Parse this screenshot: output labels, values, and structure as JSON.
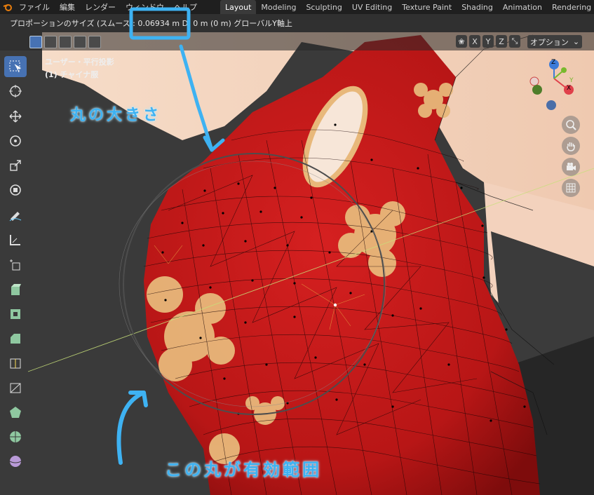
{
  "menu": {
    "items": [
      "ファイル",
      "編集",
      "レンダー",
      "ウィンドウ",
      "ヘルプ"
    ]
  },
  "workspaces": {
    "tabs": [
      "Layout",
      "Modeling",
      "Sculpting",
      "UV Editing",
      "Texture Paint",
      "Shading",
      "Animation",
      "Rendering"
    ],
    "active": "Layout"
  },
  "status": {
    "text": "プロポーションのサイズ (スムース : 0.06934 m   D: 0 m (0 m) グローバルY軸上"
  },
  "header": {
    "axis_labels": [
      "X",
      "Y",
      "Z"
    ],
    "options_label": "オプション"
  },
  "viewport": {
    "view_label": "ユーザー・平行投影",
    "object_label": "(1) チャイナ服"
  },
  "gizmo": {
    "x": "X",
    "y": "Y",
    "z": "Z",
    "colors": {
      "x": "#e0404a",
      "y": "#78b92d",
      "z": "#3c7bd8"
    }
  },
  "annotations": {
    "circle_size": "丸の大きさ",
    "effective_range": "この丸が有効範囲"
  },
  "colors": {
    "dress": "#c41a1a",
    "flower": "#e8b87a",
    "annotation": "#3eb2f2",
    "active_tool": "#4772b3"
  }
}
